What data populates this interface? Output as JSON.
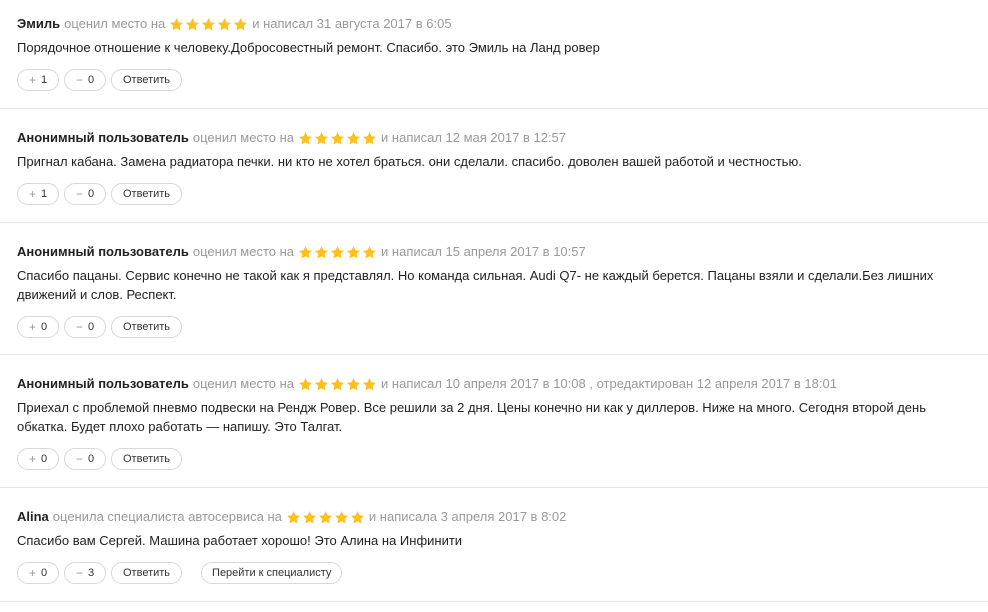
{
  "colors": {
    "star": "#fcc01f",
    "meta_text": "#999999",
    "divider": "#e6e6e6"
  },
  "reviews": [
    {
      "author": "Эмиль",
      "meta_before": "оценил место на",
      "rating": 5,
      "meta_after": "и написал 31 августа 2017 в 6:05",
      "text": "Порядочное отношение к человеку.Добросовестный ремонт. Спасибо. это Эмиль на Ланд ровер",
      "upvotes": "1",
      "downvotes": "0",
      "reply_label": "Ответить"
    },
    {
      "author": "Анонимный пользователь",
      "meta_before": "оценил место на",
      "rating": 5,
      "meta_after": "и написал 12 мая 2017 в 12:57",
      "text": "Пригнал кабана. Замена радиатора печки. ни кто не хотел браться. они сделали. спасибо. доволен вашей работой и честностью.",
      "upvotes": "1",
      "downvotes": "0",
      "reply_label": "Ответить"
    },
    {
      "author": "Анонимный пользователь",
      "meta_before": "оценил место на",
      "rating": 5,
      "meta_after": "и написал 15 апреля 2017 в 10:57",
      "text": "Спасибо пацаны. Сервис конечно не такой как я представлял. Но команда сильная. Audi Q7- не каждый берется. Пацаны взяли и сделали.Без лишних движений и слов. Респект.",
      "upvotes": "0",
      "downvotes": "0",
      "reply_label": "Ответить"
    },
    {
      "author": "Анонимный пользователь",
      "meta_before": "оценил место на",
      "rating": 5,
      "meta_after": "и написал 10 апреля 2017 в 10:08 , отредактирован 12 апреля 2017 в 18:01",
      "text": "Приехал с проблемой пневмо подвески на Рендж Ровер. Все решили за 2 дня. Цены конечно ни как у диллеров. Ниже на много. Сегодня второй день обкатка. Будет плохо работать — напишу. Это Талгат.",
      "upvotes": "0",
      "downvotes": "0",
      "reply_label": "Ответить"
    },
    {
      "author": "Alina",
      "meta_before": "оценила специалиста автосервиса на",
      "rating": 5,
      "meta_after": "и написала 3 апреля 2017 в 8:02",
      "text": "Спасибо вам Сергей. Машина работает хорошо! Это Алина на Инфинити",
      "upvotes": "0",
      "downvotes": "3",
      "reply_label": "Ответить",
      "goto_label": "Перейти к специалисту"
    }
  ]
}
